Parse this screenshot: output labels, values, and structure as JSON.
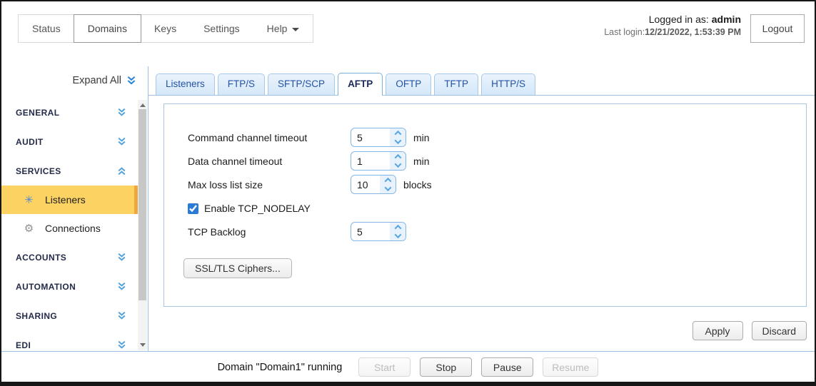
{
  "header": {
    "nav": [
      {
        "label": "Status",
        "selected": false
      },
      {
        "label": "Domains",
        "selected": true
      },
      {
        "label": "Keys",
        "selected": false
      },
      {
        "label": "Settings",
        "selected": false
      },
      {
        "label": "Help",
        "selected": false,
        "has_caret": true
      }
    ],
    "login": {
      "label": "Logged in as:",
      "user": "admin",
      "last_login_label": "Last login:",
      "last_login_value": "12/21/2022, 1:53:39 PM"
    },
    "logout_label": "Logout"
  },
  "sidebar": {
    "expand_all_label": "Expand All",
    "sections": [
      {
        "label": "GENERAL",
        "state": "collapsed"
      },
      {
        "label": "AUDIT",
        "state": "collapsed"
      },
      {
        "label": "SERVICES",
        "state": "expanded",
        "items": [
          {
            "label": "Listeners",
            "icon": "listeners-icon",
            "selected": true
          },
          {
            "label": "Connections",
            "icon": "gear-icon",
            "selected": false
          }
        ]
      },
      {
        "label": "ACCOUNTS",
        "state": "collapsed"
      },
      {
        "label": "AUTOMATION",
        "state": "collapsed"
      },
      {
        "label": "SHARING",
        "state": "collapsed"
      },
      {
        "label": "EDI",
        "state": "collapsed"
      }
    ],
    "icons": {
      "listeners_glyph": "✳",
      "gear_glyph": "⚙"
    }
  },
  "tabs": [
    {
      "label": "Listeners",
      "active": false
    },
    {
      "label": "FTP/S",
      "active": false
    },
    {
      "label": "SFTP/SCP",
      "active": false
    },
    {
      "label": "AFTP",
      "active": true
    },
    {
      "label": "OFTP",
      "active": false
    },
    {
      "label": "TFTP",
      "active": false
    },
    {
      "label": "HTTP/S",
      "active": false
    }
  ],
  "form": {
    "fields": [
      {
        "label": "Command channel timeout",
        "value": "5",
        "unit": "min"
      },
      {
        "label": "Data channel timeout",
        "value": "1",
        "unit": "min"
      },
      {
        "label": "Max loss list size",
        "value": "10",
        "unit": "blocks"
      }
    ],
    "tcp_nodelay": {
      "label": "Enable TCP_NODELAY",
      "checked": true
    },
    "tcp_backlog": {
      "label": "TCP Backlog",
      "value": "5"
    },
    "ssl_button_label": "SSL/TLS Ciphers...",
    "apply_label": "Apply",
    "discard_label": "Discard"
  },
  "footer": {
    "status_text": "Domain \"Domain1\" running",
    "buttons": [
      {
        "label": "Start",
        "disabled": true
      },
      {
        "label": "Stop",
        "disabled": false
      },
      {
        "label": "Pause",
        "disabled": false
      },
      {
        "label": "Resume",
        "disabled": true
      }
    ]
  },
  "colors": {
    "accent_blue_line": "#9dc0e5",
    "tab_text_blue": "#2253a8",
    "selected_item_bg": "#fcd363",
    "selected_item_strip": "#efa63a",
    "checkbox_blue": "#2b7bd4",
    "spinner_border": "#84b6e5"
  }
}
